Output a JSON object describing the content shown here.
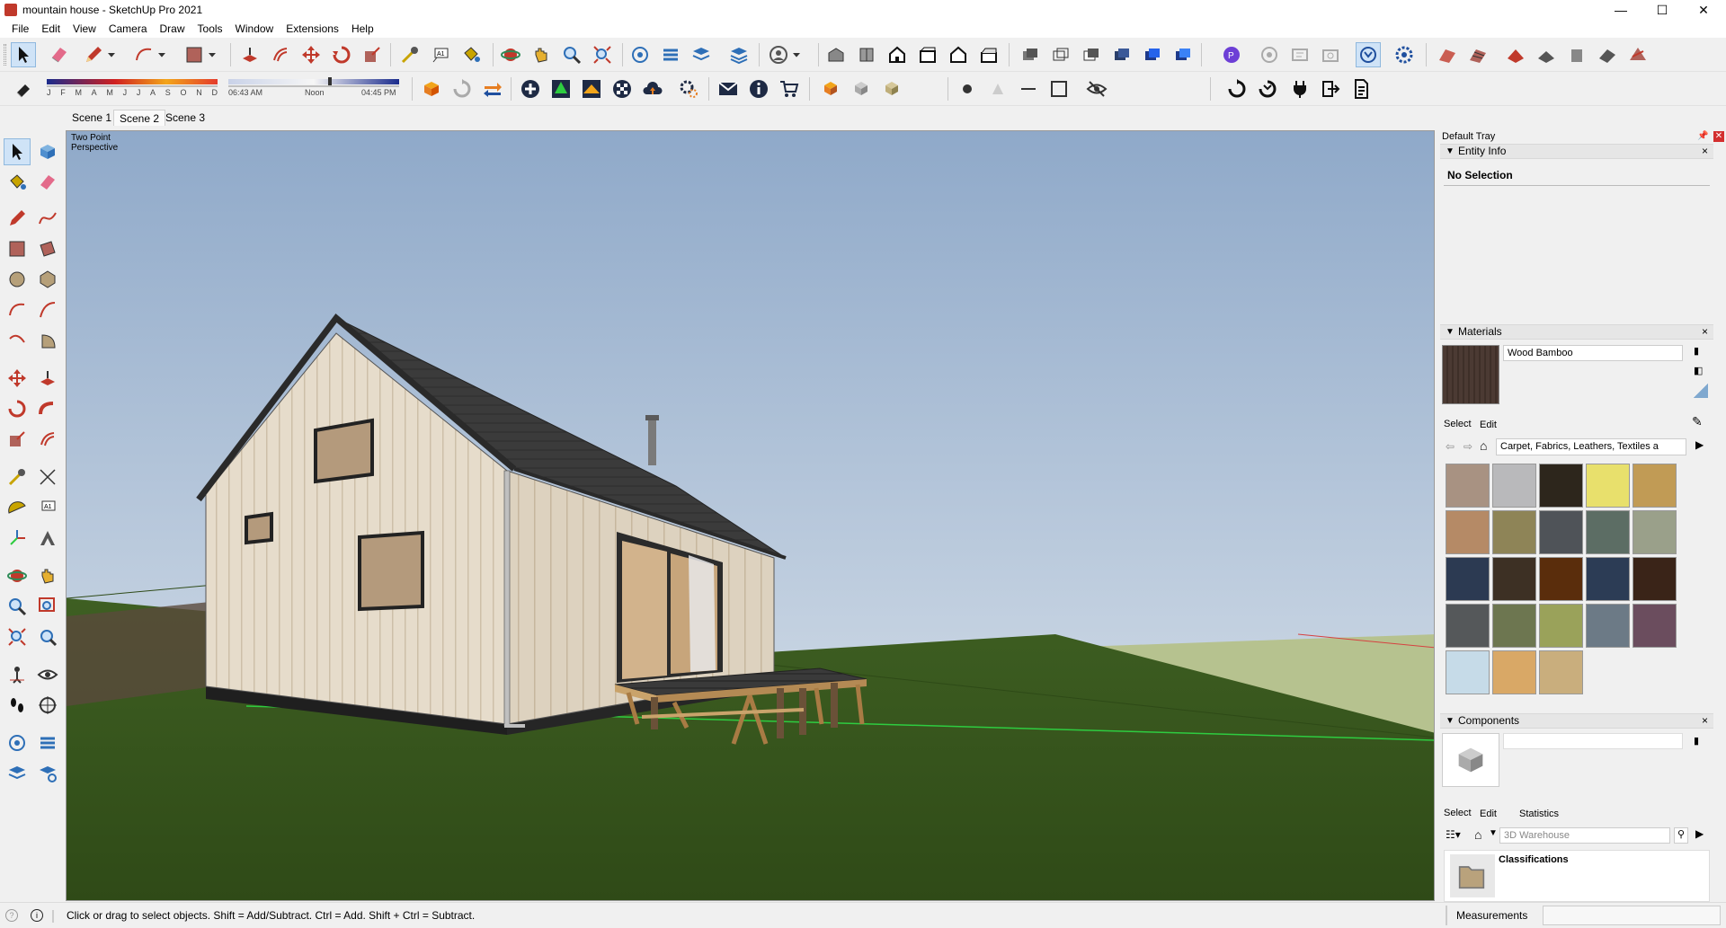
{
  "window": {
    "title": "mountain house - SketchUp Pro 2021",
    "minimize": "—",
    "maximize": "☐",
    "close": "✕"
  },
  "menu": [
    "File",
    "Edit",
    "View",
    "Camera",
    "Draw",
    "Tools",
    "Window",
    "Extensions",
    "Help"
  ],
  "shadows": {
    "months": [
      "J",
      "F",
      "M",
      "A",
      "M",
      "J",
      "J",
      "A",
      "S",
      "O",
      "N",
      "D"
    ],
    "time_start": "06:43 AM",
    "time_mid": "Noon",
    "time_end": "04:45 PM"
  },
  "scenes": [
    {
      "label": "Scene 1",
      "active": false
    },
    {
      "label": "Scene 2",
      "active": true
    },
    {
      "label": "Scene 3",
      "active": false
    }
  ],
  "viewport": {
    "camera_label": "Two Point Perspective",
    "sky_top": "#8fa9c9",
    "sky_bottom": "#dfe6ed",
    "grass": "#3a5a1d",
    "roof": "#3b3b3b",
    "siding": "#e6dccb"
  },
  "tray": {
    "title": "Default Tray",
    "entity_info": {
      "title": "Entity Info",
      "selection": "No Selection"
    },
    "materials": {
      "title": "Materials",
      "current": "Wood Bamboo",
      "tabs": [
        "Select",
        "Edit"
      ],
      "library": "Carpet, Fabrics, Leathers, Textiles a",
      "swatch_colors": [
        "#a89282",
        "#b9b9bb",
        "#2d261c",
        "#e8e06c",
        "#c19b55",
        "#b58a66",
        "#8e8457",
        "#4f5358",
        "#5c6d64",
        "#9aa08a",
        "#2c3a52",
        "#3d3024",
        "#5a2d0c",
        "#2c3c55",
        "#3a2418",
        "#55585a",
        "#6d7650",
        "#9aa25a",
        "#6c7a86",
        "#6b4d5e",
        "#c6dbe8",
        "#d9a866",
        "#c9ae7d"
      ]
    },
    "components": {
      "title": "Components",
      "tabs": [
        "Select",
        "Edit",
        "Statistics"
      ],
      "search_placeholder": "3D Warehouse",
      "result_title": "Classifications"
    }
  },
  "status": {
    "message": "Click or drag to select objects. Shift = Add/Subtract. Ctrl = Add. Shift + Ctrl = Subtract.",
    "measurements_label": "Measurements"
  }
}
